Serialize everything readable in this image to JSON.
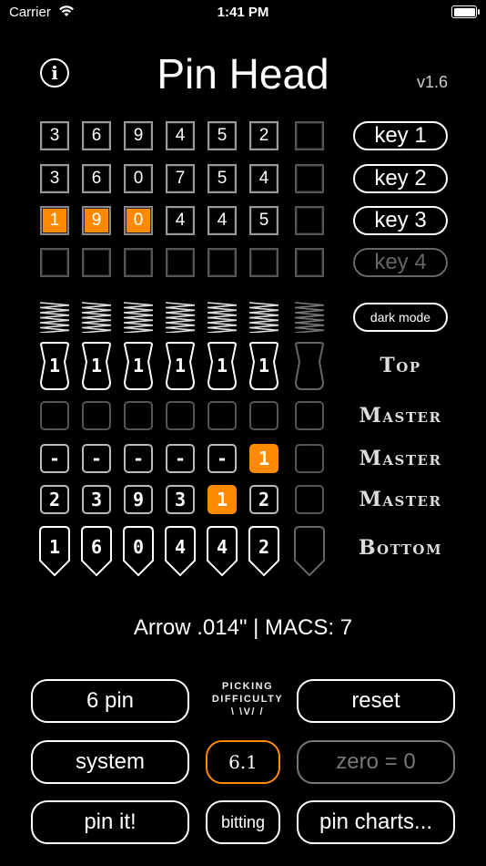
{
  "status": {
    "carrier": "Carrier",
    "time": "1:41 PM"
  },
  "header": {
    "title": "Pin Head",
    "version": "v1.6"
  },
  "keys": {
    "rows": [
      {
        "cells": [
          "3",
          "6",
          "9",
          "4",
          "5",
          "2",
          ""
        ],
        "highlight": []
      },
      {
        "cells": [
          "3",
          "6",
          "0",
          "7",
          "5",
          "4",
          ""
        ],
        "highlight": []
      },
      {
        "cells": [
          "1",
          "9",
          "0",
          "4",
          "4",
          "5",
          ""
        ],
        "highlight": [
          0,
          1,
          2
        ]
      },
      {
        "cells": [
          "",
          "",
          "",
          "",
          "",
          "",
          ""
        ],
        "highlight": []
      }
    ],
    "labels": [
      "key 1",
      "key 2",
      "key 3",
      "key 4"
    ],
    "disabled": [
      false,
      false,
      false,
      true
    ]
  },
  "dark_mode_label": "dark mode",
  "top_pins": [
    "1",
    "1",
    "1",
    "1",
    "1",
    "1",
    ""
  ],
  "top_label": "Top",
  "master_rows": [
    {
      "cells": [
        "",
        "",
        "",
        "",
        "",
        "",
        ""
      ],
      "highlight": []
    },
    {
      "cells": [
        "-",
        "-",
        "-",
        "-",
        "-",
        "1",
        ""
      ],
      "highlight": [
        5
      ]
    },
    {
      "cells": [
        "2",
        "3",
        "9",
        "3",
        "1",
        "2",
        ""
      ],
      "highlight": [
        4
      ]
    }
  ],
  "master_label": "Master",
  "bottom_pins": [
    "1",
    "6",
    "0",
    "4",
    "4",
    "2",
    ""
  ],
  "bottom_label": "Bottom",
  "info_line": "Arrow .014\" | MACS: 7",
  "controls": {
    "pins_button": "6 pin",
    "picking_difficulty_line1": "PICKING",
    "picking_difficulty_line2": "DIFFICULTY",
    "picking_difficulty_line3": "\\ \\V/ /",
    "reset_button": "reset",
    "system_button": "system",
    "difficulty_value": "6.1",
    "zero_button": "zero = 0",
    "pin_it_button": "pin it!",
    "bitting_button": "bitting",
    "pin_charts_button": "pin charts..."
  },
  "colors": {
    "accent": "#ff8a00",
    "background": "#000000"
  }
}
